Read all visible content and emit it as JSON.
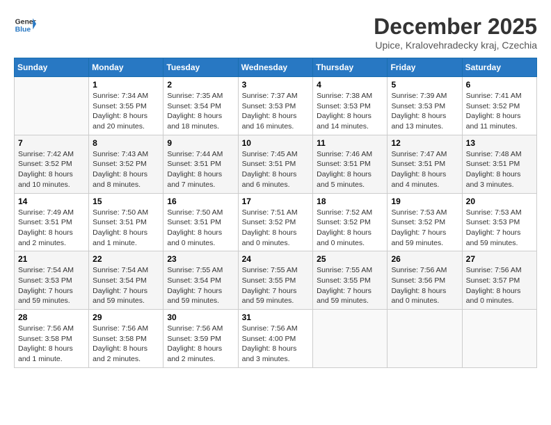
{
  "logo": {
    "line1": "General",
    "line2": "Blue"
  },
  "title": "December 2025",
  "subtitle": "Upice, Kralovehradecky kraj, Czechia",
  "weekdays": [
    "Sunday",
    "Monday",
    "Tuesday",
    "Wednesday",
    "Thursday",
    "Friday",
    "Saturday"
  ],
  "weeks": [
    [
      {
        "day": "",
        "sunrise": "",
        "sunset": "",
        "daylight": ""
      },
      {
        "day": "1",
        "sunrise": "Sunrise: 7:34 AM",
        "sunset": "Sunset: 3:55 PM",
        "daylight": "Daylight: 8 hours and 20 minutes."
      },
      {
        "day": "2",
        "sunrise": "Sunrise: 7:35 AM",
        "sunset": "Sunset: 3:54 PM",
        "daylight": "Daylight: 8 hours and 18 minutes."
      },
      {
        "day": "3",
        "sunrise": "Sunrise: 7:37 AM",
        "sunset": "Sunset: 3:53 PM",
        "daylight": "Daylight: 8 hours and 16 minutes."
      },
      {
        "day": "4",
        "sunrise": "Sunrise: 7:38 AM",
        "sunset": "Sunset: 3:53 PM",
        "daylight": "Daylight: 8 hours and 14 minutes."
      },
      {
        "day": "5",
        "sunrise": "Sunrise: 7:39 AM",
        "sunset": "Sunset: 3:53 PM",
        "daylight": "Daylight: 8 hours and 13 minutes."
      },
      {
        "day": "6",
        "sunrise": "Sunrise: 7:41 AM",
        "sunset": "Sunset: 3:52 PM",
        "daylight": "Daylight: 8 hours and 11 minutes."
      }
    ],
    [
      {
        "day": "7",
        "sunrise": "Sunrise: 7:42 AM",
        "sunset": "Sunset: 3:52 PM",
        "daylight": "Daylight: 8 hours and 10 minutes."
      },
      {
        "day": "8",
        "sunrise": "Sunrise: 7:43 AM",
        "sunset": "Sunset: 3:52 PM",
        "daylight": "Daylight: 8 hours and 8 minutes."
      },
      {
        "day": "9",
        "sunrise": "Sunrise: 7:44 AM",
        "sunset": "Sunset: 3:51 PM",
        "daylight": "Daylight: 8 hours and 7 minutes."
      },
      {
        "day": "10",
        "sunrise": "Sunrise: 7:45 AM",
        "sunset": "Sunset: 3:51 PM",
        "daylight": "Daylight: 8 hours and 6 minutes."
      },
      {
        "day": "11",
        "sunrise": "Sunrise: 7:46 AM",
        "sunset": "Sunset: 3:51 PM",
        "daylight": "Daylight: 8 hours and 5 minutes."
      },
      {
        "day": "12",
        "sunrise": "Sunrise: 7:47 AM",
        "sunset": "Sunset: 3:51 PM",
        "daylight": "Daylight: 8 hours and 4 minutes."
      },
      {
        "day": "13",
        "sunrise": "Sunrise: 7:48 AM",
        "sunset": "Sunset: 3:51 PM",
        "daylight": "Daylight: 8 hours and 3 minutes."
      }
    ],
    [
      {
        "day": "14",
        "sunrise": "Sunrise: 7:49 AM",
        "sunset": "Sunset: 3:51 PM",
        "daylight": "Daylight: 8 hours and 2 minutes."
      },
      {
        "day": "15",
        "sunrise": "Sunrise: 7:50 AM",
        "sunset": "Sunset: 3:51 PM",
        "daylight": "Daylight: 8 hours and 1 minute."
      },
      {
        "day": "16",
        "sunrise": "Sunrise: 7:50 AM",
        "sunset": "Sunset: 3:51 PM",
        "daylight": "Daylight: 8 hours and 0 minutes."
      },
      {
        "day": "17",
        "sunrise": "Sunrise: 7:51 AM",
        "sunset": "Sunset: 3:52 PM",
        "daylight": "Daylight: 8 hours and 0 minutes."
      },
      {
        "day": "18",
        "sunrise": "Sunrise: 7:52 AM",
        "sunset": "Sunset: 3:52 PM",
        "daylight": "Daylight: 8 hours and 0 minutes."
      },
      {
        "day": "19",
        "sunrise": "Sunrise: 7:53 AM",
        "sunset": "Sunset: 3:52 PM",
        "daylight": "Daylight: 7 hours and 59 minutes."
      },
      {
        "day": "20",
        "sunrise": "Sunrise: 7:53 AM",
        "sunset": "Sunset: 3:53 PM",
        "daylight": "Daylight: 7 hours and 59 minutes."
      }
    ],
    [
      {
        "day": "21",
        "sunrise": "Sunrise: 7:54 AM",
        "sunset": "Sunset: 3:53 PM",
        "daylight": "Daylight: 7 hours and 59 minutes."
      },
      {
        "day": "22",
        "sunrise": "Sunrise: 7:54 AM",
        "sunset": "Sunset: 3:54 PM",
        "daylight": "Daylight: 7 hours and 59 minutes."
      },
      {
        "day": "23",
        "sunrise": "Sunrise: 7:55 AM",
        "sunset": "Sunset: 3:54 PM",
        "daylight": "Daylight: 7 hours and 59 minutes."
      },
      {
        "day": "24",
        "sunrise": "Sunrise: 7:55 AM",
        "sunset": "Sunset: 3:55 PM",
        "daylight": "Daylight: 7 hours and 59 minutes."
      },
      {
        "day": "25",
        "sunrise": "Sunrise: 7:55 AM",
        "sunset": "Sunset: 3:55 PM",
        "daylight": "Daylight: 7 hours and 59 minutes."
      },
      {
        "day": "26",
        "sunrise": "Sunrise: 7:56 AM",
        "sunset": "Sunset: 3:56 PM",
        "daylight": "Daylight: 8 hours and 0 minutes."
      },
      {
        "day": "27",
        "sunrise": "Sunrise: 7:56 AM",
        "sunset": "Sunset: 3:57 PM",
        "daylight": "Daylight: 8 hours and 0 minutes."
      }
    ],
    [
      {
        "day": "28",
        "sunrise": "Sunrise: 7:56 AM",
        "sunset": "Sunset: 3:58 PM",
        "daylight": "Daylight: 8 hours and 1 minute."
      },
      {
        "day": "29",
        "sunrise": "Sunrise: 7:56 AM",
        "sunset": "Sunset: 3:58 PM",
        "daylight": "Daylight: 8 hours and 2 minutes."
      },
      {
        "day": "30",
        "sunrise": "Sunrise: 7:56 AM",
        "sunset": "Sunset: 3:59 PM",
        "daylight": "Daylight: 8 hours and 2 minutes."
      },
      {
        "day": "31",
        "sunrise": "Sunrise: 7:56 AM",
        "sunset": "Sunset: 4:00 PM",
        "daylight": "Daylight: 8 hours and 3 minutes."
      },
      {
        "day": "",
        "sunrise": "",
        "sunset": "",
        "daylight": ""
      },
      {
        "day": "",
        "sunrise": "",
        "sunset": "",
        "daylight": ""
      },
      {
        "day": "",
        "sunrise": "",
        "sunset": "",
        "daylight": ""
      }
    ]
  ]
}
